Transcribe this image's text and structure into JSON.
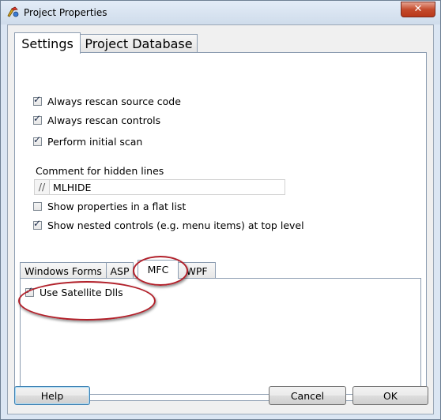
{
  "window": {
    "title": "Project Properties",
    "close_glyph": "✕"
  },
  "main_tabs": [
    {
      "label": "Settings",
      "active": true
    },
    {
      "label": "Project Database",
      "active": false
    }
  ],
  "settings": {
    "always_rescan_source": {
      "label": "Always rescan source code",
      "checked": true
    },
    "always_rescan_controls": {
      "label": "Always rescan controls",
      "checked": true
    },
    "perform_initial_scan": {
      "label": "Perform initial scan",
      "checked": true
    },
    "comment": {
      "label": "Comment for hidden lines",
      "prefix": "//",
      "value": "MLHIDE"
    },
    "flat_list": {
      "label": "Show properties in a flat list",
      "checked": false
    },
    "nested_controls": {
      "label": "Show nested controls (e.g. menu items) at top level",
      "checked": true
    }
  },
  "sub_tabs": [
    {
      "label": "Windows Forms",
      "active": false
    },
    {
      "label": "ASP",
      "active": false
    },
    {
      "label": "MFC",
      "active": true
    },
    {
      "label": "WPF",
      "active": false
    }
  ],
  "mfc": {
    "use_satellite_dlls": {
      "label": "Use Satellite Dlls",
      "checked": true
    }
  },
  "buttons": {
    "help": "Help",
    "cancel": "Cancel",
    "ok": "OK"
  },
  "icons": {
    "app_icon": "project-properties-icon",
    "check": "check-icon",
    "close": "close-icon"
  },
  "colors": {
    "annotation_red": "#b2202a",
    "title_bar": "#dbe6f3",
    "close_red": "#c44b2d"
  }
}
